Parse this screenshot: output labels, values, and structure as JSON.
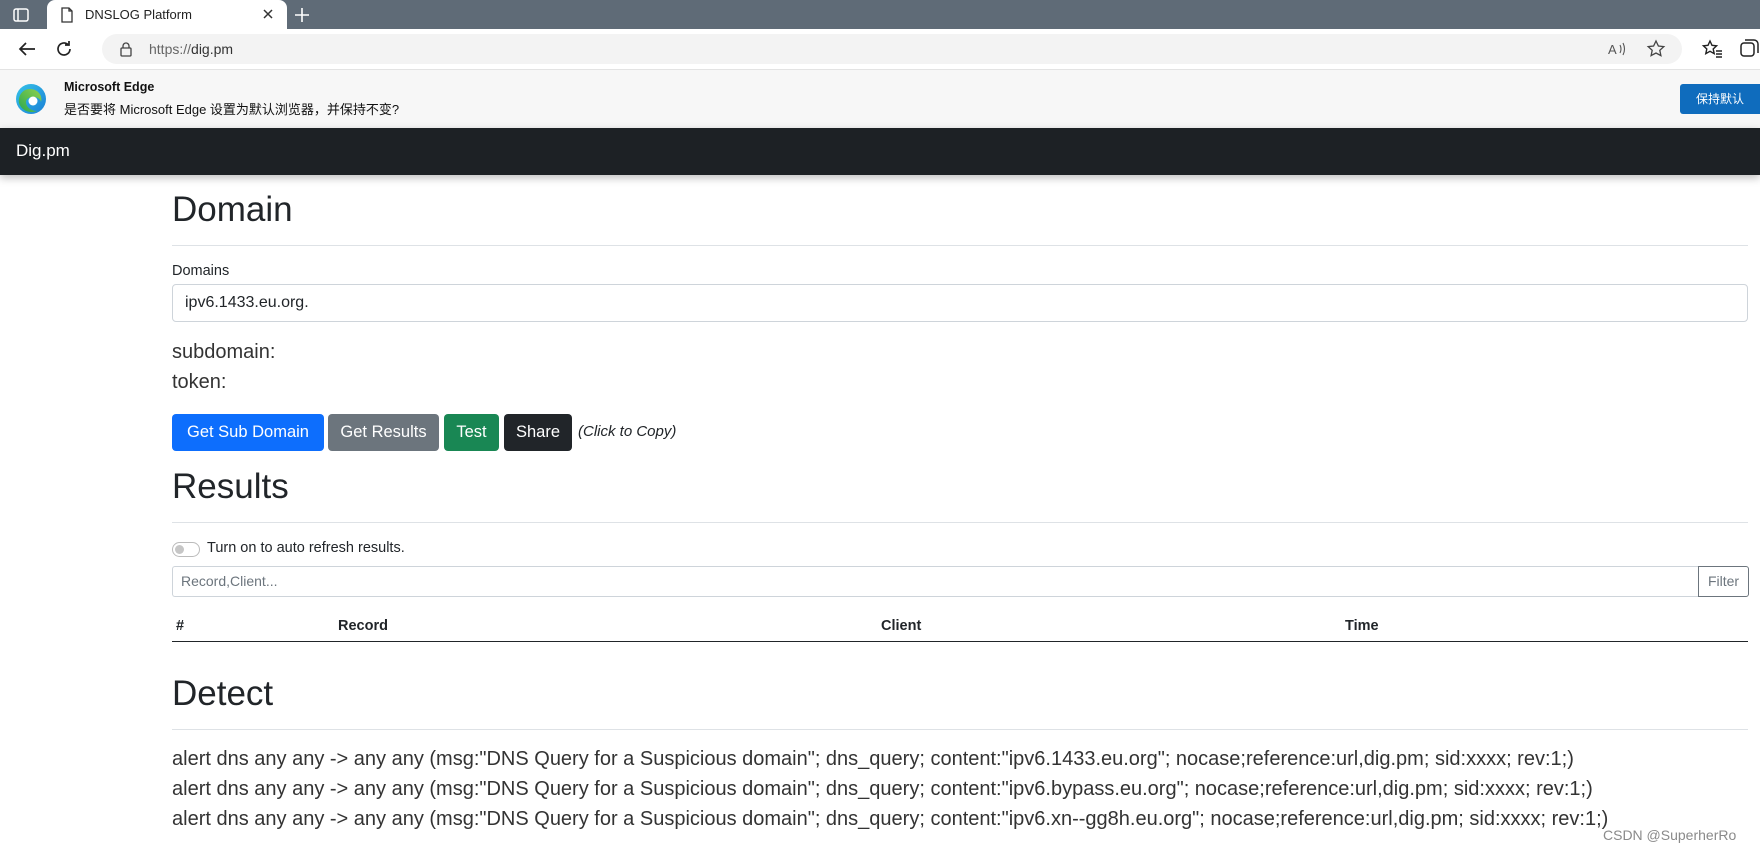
{
  "browser": {
    "tab_title": "DNSLOG Platform",
    "url_scheme": "https://",
    "url_host": "dig.pm"
  },
  "infobar": {
    "title": "Microsoft Edge",
    "message": "是否要将 Microsoft Edge 设置为默认浏览器，并保持不变?",
    "button": "保持默认"
  },
  "site": {
    "brand": "Dig.pm"
  },
  "domain_section": {
    "heading": "Domain",
    "domains_label": "Domains",
    "domains_value": "ipv6.1433.eu.org.",
    "subdomain_label": "subdomain:",
    "token_label": "token:"
  },
  "actions": {
    "get_sub_domain": "Get Sub Domain",
    "get_results": "Get Results",
    "test": "Test",
    "share": "Share",
    "copy_hint": "(Click to Copy)",
    "colors": {
      "primary": "#0d6efd",
      "secondary": "#6c757d",
      "success": "#198754",
      "dark": "#212529"
    }
  },
  "results_section": {
    "heading": "Results",
    "auto_refresh_label": "Turn on to auto refresh results.",
    "auto_refresh_on": false,
    "filter_placeholder": "Record,Client...",
    "filter_button": "Filter",
    "columns": [
      "#",
      "Record",
      "Client",
      "Time"
    ]
  },
  "detect_section": {
    "heading": "Detect",
    "rules": [
      "alert dns any any -> any any (msg:\"DNS Query for a Suspicious domain\"; dns_query; content:\"ipv6.1433.eu.org\"; nocase;reference:url,dig.pm; sid:xxxx; rev:1;)",
      "alert dns any any -> any any (msg:\"DNS Query for a Suspicious domain\"; dns_query; content:\"ipv6.bypass.eu.org\"; nocase;reference:url,dig.pm; sid:xxxx; rev:1;)",
      "alert dns any any -> any any (msg:\"DNS Query for a Suspicious domain\"; dns_query; content:\"ipv6.xn--gg8h.eu.org\"; nocase;reference:url,dig.pm; sid:xxxx; rev:1;)"
    ]
  },
  "watermark": "CSDN @SuperherRo"
}
